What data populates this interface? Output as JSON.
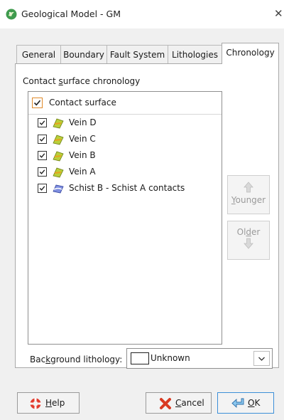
{
  "window": {
    "title": "Geological Model - GM",
    "close_glyph": "✕"
  },
  "tabs": [
    {
      "label": "General"
    },
    {
      "label": "Boundary"
    },
    {
      "label": "Fault System"
    },
    {
      "label": "Lithologies"
    },
    {
      "label": "Chronology",
      "active": true
    }
  ],
  "chronology": {
    "group_label_pre": "Contact ",
    "group_label_mnemonic": "s",
    "group_label_post": "urface chronology",
    "header_label": "Contact surface",
    "items": [
      {
        "label": "Vein D",
        "checked": true,
        "icon": "vein-surface-icon"
      },
      {
        "label": "Vein C",
        "checked": true,
        "icon": "vein-surface-icon"
      },
      {
        "label": "Vein B",
        "checked": true,
        "icon": "vein-surface-icon"
      },
      {
        "label": "Vein A",
        "checked": true,
        "icon": "vein-surface-icon"
      },
      {
        "label": "Schist B - Schist A contacts",
        "checked": true,
        "icon": "contact-surface-icon"
      }
    ],
    "younger": {
      "pre": "",
      "mnemonic": "Y",
      "post": "ounger"
    },
    "older": {
      "pre": "Ol",
      "mnemonic": "d",
      "post": "er"
    }
  },
  "background": {
    "label_pre": "Bac",
    "label_mnemonic": "k",
    "label_post": "ground lithology:",
    "value": "Unknown",
    "swatch_color": "#ffffff"
  },
  "buttons": {
    "help": {
      "mnemonic": "H",
      "rest": "elp"
    },
    "cancel": {
      "mnemonic": "C",
      "rest": "ancel"
    },
    "ok": {
      "mnemonic": "O",
      "rest": "K"
    }
  },
  "colors": {
    "accent": "#3c8fd8",
    "header_checkbox_border": "#e08a2a",
    "disabled_text": "#9a9a9a"
  }
}
